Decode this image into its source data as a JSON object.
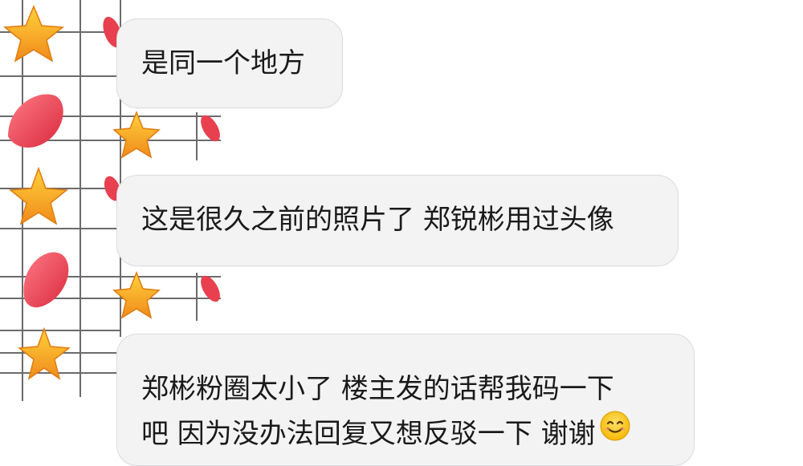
{
  "messages": [
    {
      "lines": [
        "是同一个地方"
      ]
    },
    {
      "lines": [
        "这是很久之前的照片了 郑锐彬用过头像"
      ]
    },
    {
      "lines": [
        "郑彬粉圈太小了 楼主发的话帮我码一下",
        "吧 因为没办法回复又想反驳一下 谢谢"
      ],
      "trailing_icon": "smiling-face-emoji"
    }
  ],
  "colors": {
    "bubble_bg": "#f3f3f4",
    "bubble_border": "#dcdcde",
    "text": "#1a1a1a",
    "grid": "#3a3a3a",
    "heart": "#e8404f",
    "star": "#f5a623"
  }
}
